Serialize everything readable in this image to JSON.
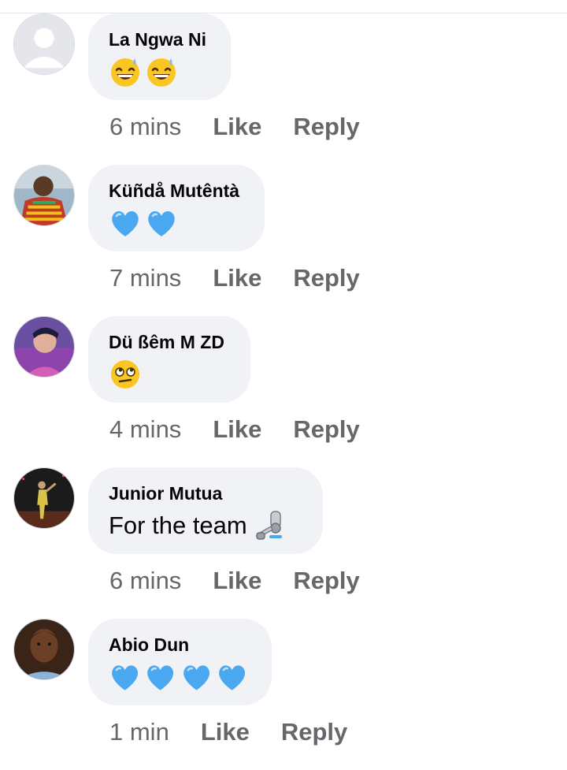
{
  "comments": [
    {
      "author": "La Ngwa Ni",
      "text": "",
      "emojis": [
        "grinning-sweat",
        "grinning-sweat"
      ],
      "time": "6 mins",
      "like_label": "Like",
      "reply_label": "Reply",
      "avatar": "default-avatar"
    },
    {
      "author": "Küñdå Mutêntà",
      "text": "",
      "emojis": [
        "blue-heart",
        "blue-heart"
      ],
      "time": "7 mins",
      "like_label": "Like",
      "reply_label": "Reply",
      "avatar": "photo-avatar"
    },
    {
      "author": "Dü ßêm M ZD",
      "text": "",
      "emojis": [
        "face-rolling-eyes"
      ],
      "time": "4 mins",
      "like_label": "Like",
      "reply_label": "Reply",
      "avatar": "photo-avatar"
    },
    {
      "author": "Junior Mutua",
      "text": "For the team",
      "emojis": [
        "mechanical-arm"
      ],
      "time": "6 mins",
      "like_label": "Like",
      "reply_label": "Reply",
      "avatar": "photo-avatar"
    },
    {
      "author": "Abio Dun",
      "text": "",
      "emojis": [
        "blue-heart",
        "blue-heart",
        "blue-heart",
        "blue-heart"
      ],
      "time": "1 min",
      "like_label": "Like",
      "reply_label": "Reply",
      "avatar": "photo-avatar"
    }
  ],
  "colors": {
    "bubble": "#f0f2f5",
    "meta_text": "#65676b",
    "author_text": "#050505",
    "blue_heart": "#4aa8f0"
  }
}
